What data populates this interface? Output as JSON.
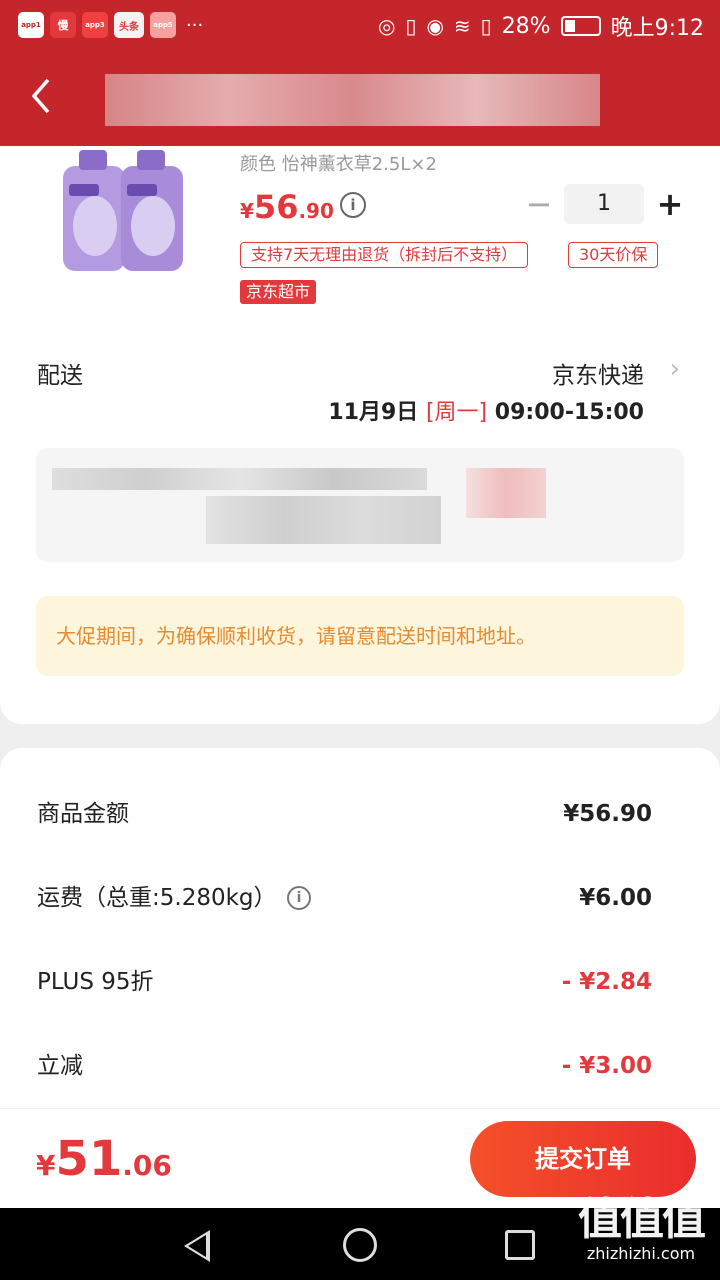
{
  "status_bar": {
    "apps": [
      "app1",
      "慢",
      "app3",
      "头条",
      "app5"
    ],
    "more": "···",
    "battery": "28%",
    "time": "晚上9:12"
  },
  "product": {
    "spec": "颜色 怡神薰衣草2.5L×2",
    "price_symbol": "¥",
    "price_int": "56",
    "price_dec": ".90",
    "quantity": "1",
    "tag_return": "支持7天无理由退货（拆封后不支持）",
    "tag_price_protect": "30天价保",
    "tag_store": "京东超市"
  },
  "delivery": {
    "label": "配送",
    "method": "京东快递",
    "date": "11月9日 ",
    "weekday": "[周一]",
    "time": " 09:00-15:00"
  },
  "notice": "大促期间，为确保顺利收货，请留意配送时间和地址。",
  "summary": {
    "goods_label": "商品金额",
    "goods_value": "¥56.90",
    "shipping_label": "运费（总重:5.280kg）",
    "shipping_value": "¥6.00",
    "plus_label": "PLUS 95折",
    "plus_value": "- ¥2.84",
    "discount_label": "立减",
    "discount_value": "- ¥3.00"
  },
  "footer": {
    "total_symbol": "¥",
    "total_int": "51",
    "total_dec": ".06",
    "submit_label": "提交订单"
  },
  "watermark": {
    "logo": "值值值",
    "text": "zhizhizhi.com"
  }
}
